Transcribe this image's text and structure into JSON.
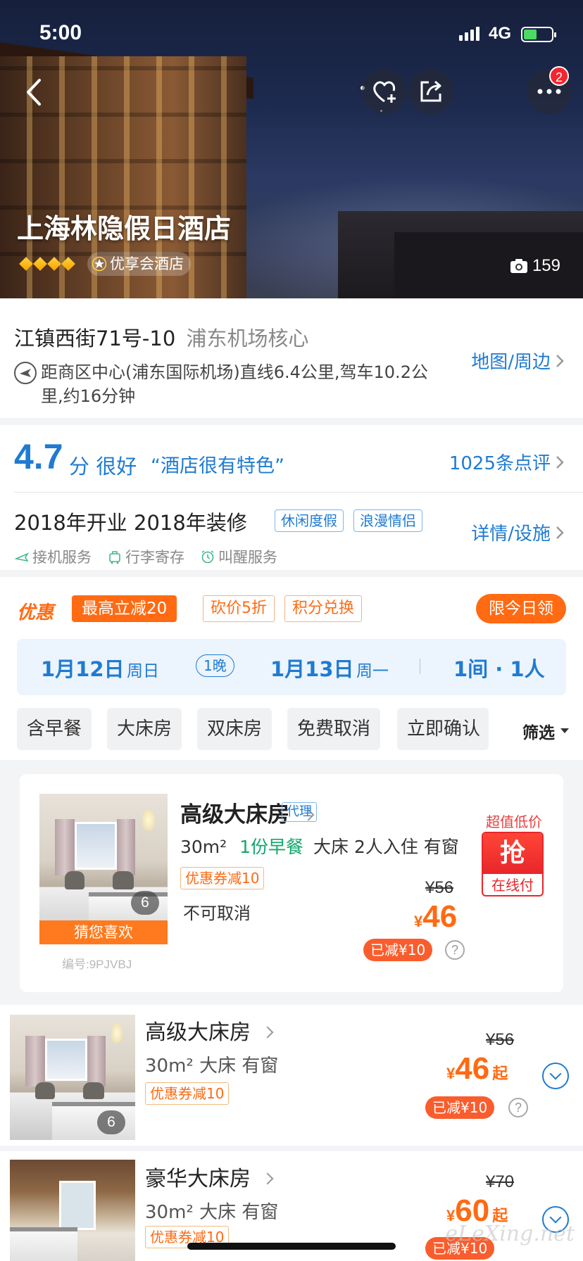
{
  "status_bar": {
    "time": "5:00",
    "network": "4G"
  },
  "hero": {
    "hotel_name": "上海林隐假日酒店",
    "member_tag": "优享会酒店",
    "photo_count": "159",
    "more_badge": "2",
    "diamond_count": 4
  },
  "address": {
    "street": "江镇西街71号-10",
    "area": "浦东机场核心",
    "distance": "距商区中心(浦东国际机场)直线6.4公里,驾车10.2公里,约16分钟",
    "map_link": "地图/周边"
  },
  "review": {
    "score": "4.7",
    "score_text": "分 很好",
    "quote": "“酒店很有特色”",
    "count_link": "1025条点评"
  },
  "facility": {
    "year_text": "2018年开业 2018年装修",
    "tags": [
      "休闲度假",
      "浪漫情侣"
    ],
    "services": [
      "接机服务",
      "行李寄存",
      "叫醒服务"
    ],
    "detail_link": "详情/设施"
  },
  "promo": {
    "label": "优惠",
    "main": "最高立减20",
    "tags": [
      "砍价5折",
      "积分兑换"
    ],
    "today_btn": "限今日领"
  },
  "dates": {
    "checkin": "1月12日",
    "checkin_week": "周日",
    "nights": "1晚",
    "checkout": "1月13日",
    "checkout_week": "周一",
    "guests": "1间 · 1人"
  },
  "filters": {
    "chips": [
      "含早餐",
      "大床房",
      "双床房",
      "免费取消",
      "立即确认"
    ],
    "filter_label": "筛选"
  },
  "featured_room": {
    "title": "高级大床房",
    "agent_tag": "代理",
    "area": "30m²",
    "breakfast": "1份早餐",
    "details": "大床 2人入住 有窗",
    "coupon": "优惠券减10",
    "cancel": "不可取消",
    "img_count": "6",
    "guess_label": "猜您喜欢",
    "code": "编号:9PJVBJ",
    "orig_price": "¥56",
    "currency": "¥",
    "price": "46",
    "cut": "已减¥10",
    "deal_label": "超值低价",
    "grab": "抢",
    "pay": "在线付"
  },
  "rooms": [
    {
      "title": "高级大床房",
      "info": "30m²  大床  有窗",
      "coupon": "优惠券减10",
      "img_count": "6",
      "orig_price": "¥56",
      "currency": "¥",
      "price": "46",
      "suffix": "起",
      "cut": "已减¥10"
    },
    {
      "title": "豪华大床房",
      "info": "30m²  大床  有窗",
      "coupon": "优惠券减10",
      "orig_price": "¥70",
      "currency": "¥",
      "price": "60",
      "suffix": "起",
      "cut": "已减¥10"
    }
  ],
  "watermark": "eLeXing.net"
}
